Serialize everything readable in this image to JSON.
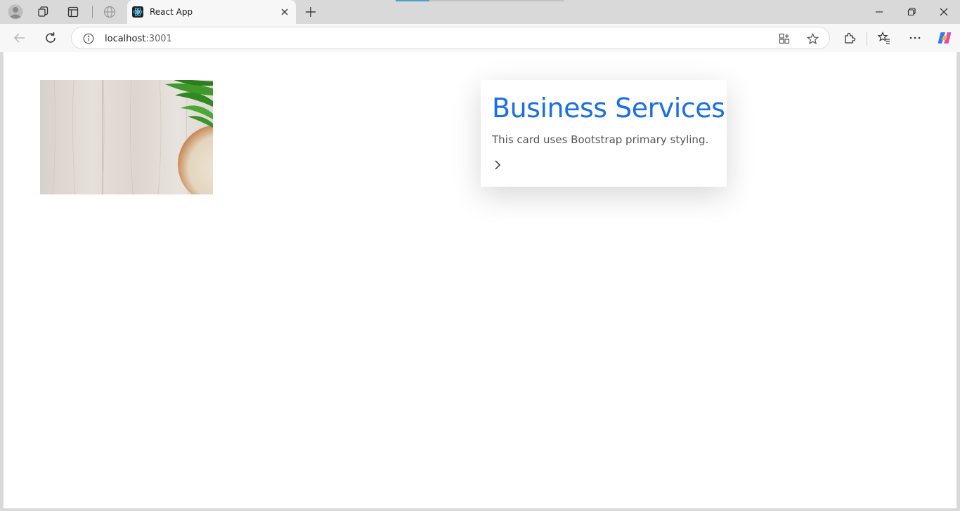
{
  "browser": {
    "tab": {
      "title": "React App"
    },
    "address": {
      "host": "localhost",
      "port": ":3001"
    }
  },
  "page": {
    "card": {
      "title": "Business Services",
      "text": "This card uses Bootstrap primary styling."
    }
  },
  "colors": {
    "primary": "#1a6fe3",
    "chrome": "#d9d9d9",
    "toolbar": "#f7f7f7"
  },
  "icons": {
    "profile": "profile-icon",
    "workspaces": "workspaces-icon",
    "tab_actions": "tab-actions-icon",
    "globe": "globe-icon",
    "react": "react-icon",
    "close": "close-icon",
    "new_tab": "plus-icon",
    "back": "back-icon",
    "refresh": "refresh-icon",
    "info": "info-icon",
    "app_install": "app-install-icon",
    "favorite": "star-icon",
    "extensions": "puzzle-icon",
    "favorites": "favorites-icon",
    "more": "more-icon",
    "copilot": "copilot-icon",
    "chevron": "chevron-right-icon"
  }
}
